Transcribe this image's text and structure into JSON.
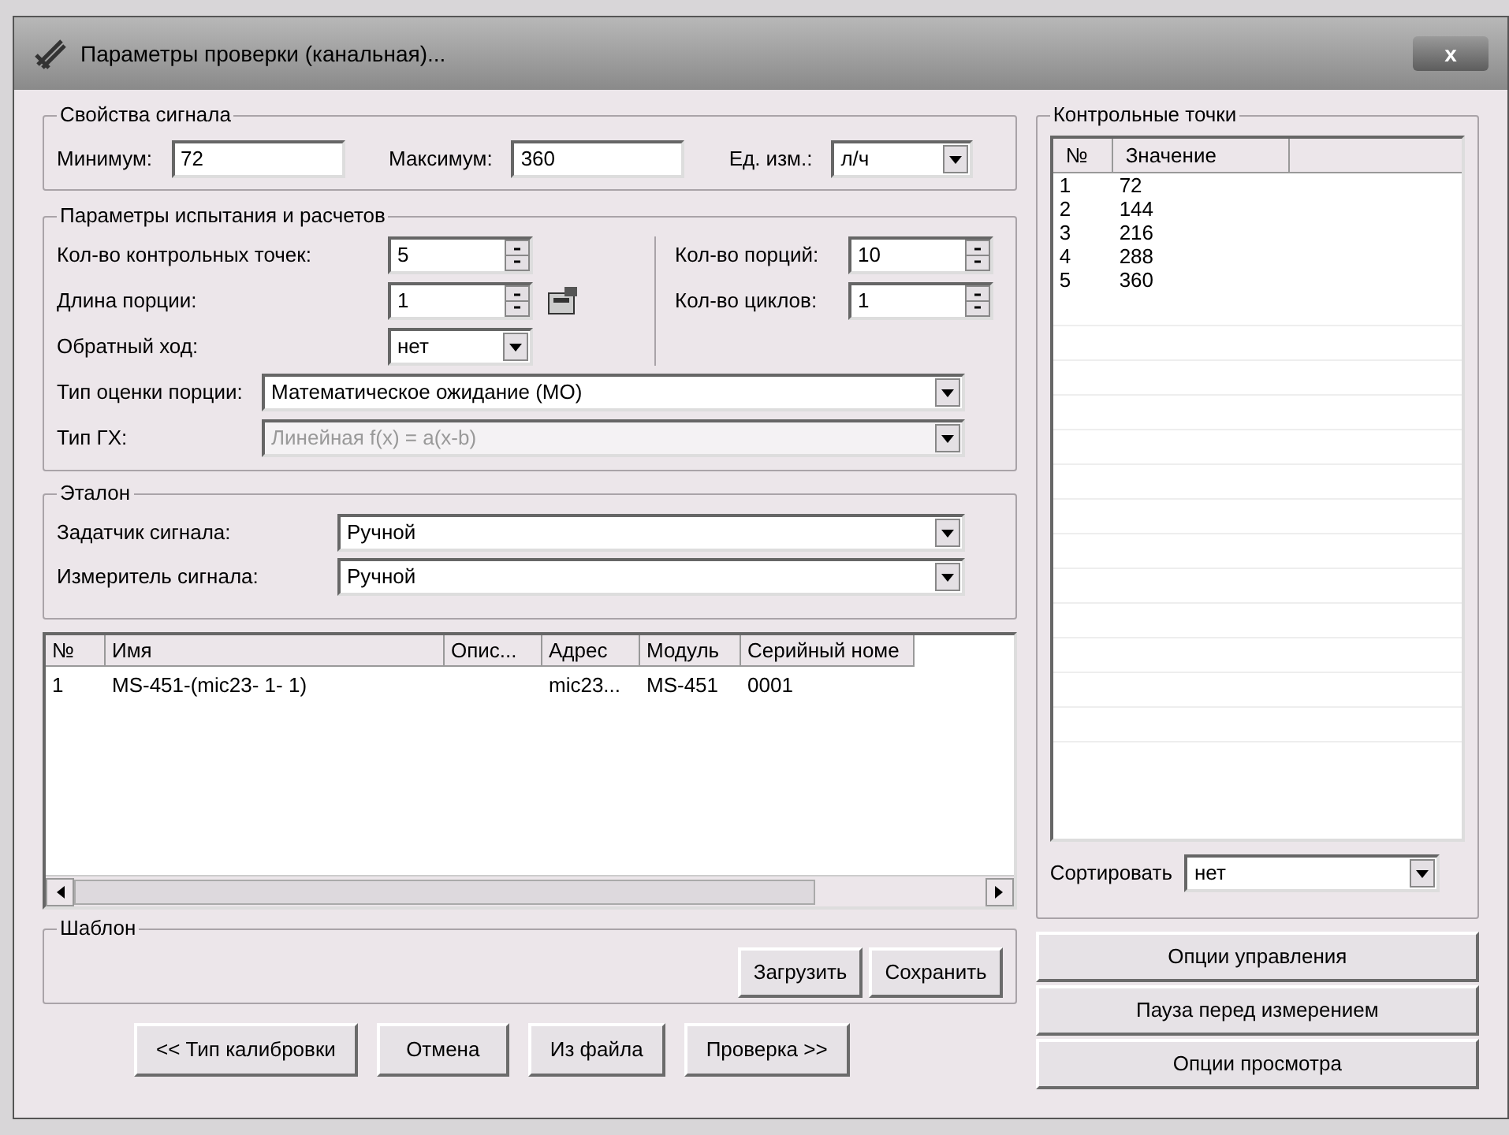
{
  "window": {
    "title": "Параметры проверки (канальная)...",
    "close": "x"
  },
  "signal_properties": {
    "title": "Свойства сигнала",
    "minimum": {
      "label": "Минимум:",
      "value": "72"
    },
    "maximum": {
      "label": "Максимум:",
      "value": "360"
    },
    "unit": {
      "label": "Ед. изм.:",
      "value": "л/ч"
    }
  },
  "test_params": {
    "title": "Параметры испытания и расчетов",
    "left_fields": [
      {
        "kind": "spin",
        "label": "Кол-во контрольных точек:",
        "value": "5"
      },
      {
        "kind": "spin_tool",
        "label": "Длина порции:",
        "value": "1"
      },
      {
        "kind": "select",
        "label": "Обратный ход:",
        "value": "нет"
      }
    ],
    "right_fields": [
      {
        "kind": "spin",
        "label": "Кол-во порций:",
        "value": "10"
      },
      {
        "kind": "spin",
        "label": "Кол-во циклов:",
        "value": "1"
      }
    ],
    "wide_fields": [
      {
        "label": "Тип оценки порции:",
        "value": "Математическое ожидание (МО)",
        "disabled": false
      },
      {
        "label": "Тип ГХ:",
        "value": "Линейная f(x) = a(x-b)",
        "disabled": true
      }
    ]
  },
  "reference": {
    "title": "Эталон",
    "fields": [
      {
        "label": "Задатчик сигнала:",
        "value": "Ручной"
      },
      {
        "label": "Измеритель сигнала:",
        "value": "Ручной"
      }
    ]
  },
  "channels_table": {
    "columns": [
      "№",
      "Имя",
      "Опис...",
      "Адрес",
      "Модуль",
      "Серийный номе"
    ],
    "rows": [
      [
        "1",
        "MS-451-(mic23- 1- 1)",
        "",
        "mic23...",
        "MS-451",
        "0001"
      ]
    ]
  },
  "template": {
    "title": "Шаблон",
    "buttons": [
      "Загрузить",
      "Сохранить"
    ]
  },
  "control_points": {
    "title": "Контрольные точки",
    "columns": [
      "№",
      "Значение"
    ],
    "rows": [
      [
        "1",
        "72"
      ],
      [
        "2",
        "144"
      ],
      [
        "3",
        "216"
      ],
      [
        "4",
        "288"
      ],
      [
        "5",
        "360"
      ]
    ],
    "sort": {
      "label": "Сортировать",
      "value": "нет"
    }
  },
  "side_buttons": [
    "Опции управления",
    "Пауза перед измерением",
    "Опции просмотра"
  ],
  "bottom_buttons": [
    "<< Тип калибровки",
    "Отмена",
    "Из файла",
    "Проверка >>"
  ]
}
